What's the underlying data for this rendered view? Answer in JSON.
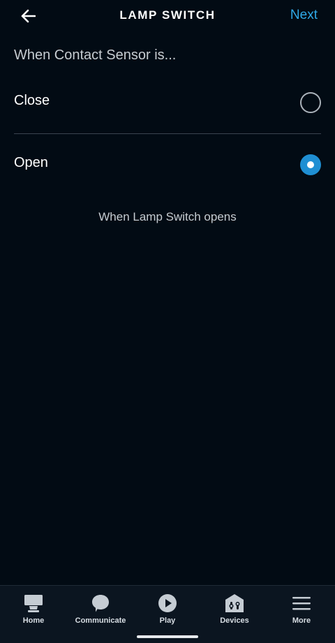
{
  "header": {
    "title": "LAMP SWITCH",
    "next_label": "Next",
    "back_icon": "back-arrow-icon"
  },
  "prompt": "When Contact Sensor is...",
  "options": [
    {
      "label": "Close",
      "selected": false
    },
    {
      "label": "Open",
      "selected": true
    }
  ],
  "summary": "When Lamp Switch opens",
  "nav": {
    "items": [
      {
        "label": "Home",
        "icon": "home-icon"
      },
      {
        "label": "Communicate",
        "icon": "communicate-icon"
      },
      {
        "label": "Play",
        "icon": "play-icon"
      },
      {
        "label": "Devices",
        "icon": "devices-icon"
      },
      {
        "label": "More",
        "icon": "more-icon"
      }
    ]
  },
  "colors": {
    "background": "#020b14",
    "accent": "#2fa8e6",
    "radio_selected": "#1f8fd3"
  }
}
